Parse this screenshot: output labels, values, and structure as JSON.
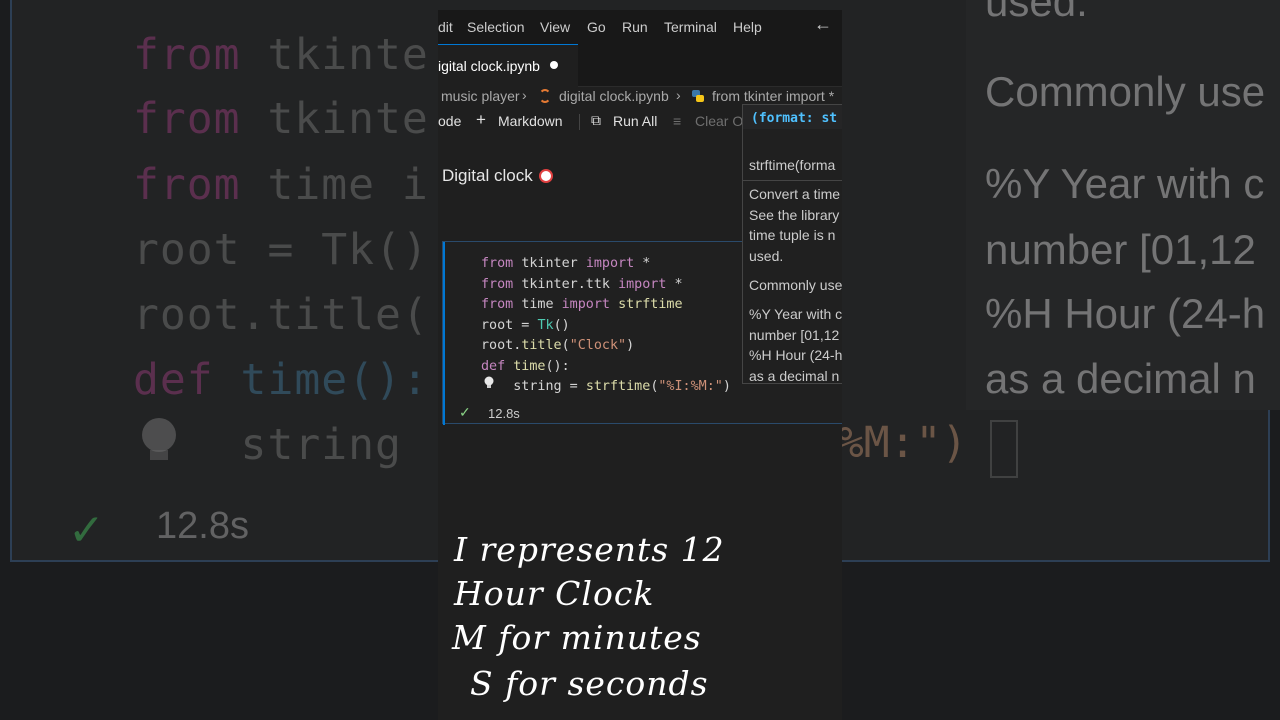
{
  "background": {
    "code_lines": [
      {
        "kw": "from",
        "rest": " tkinte"
      },
      {
        "kw": "from",
        "rest": " tkinte"
      },
      {
        "kw": "from",
        "rest": " time i"
      },
      {
        "kw": "",
        "rest": "root = Tk()"
      },
      {
        "kw": "",
        "rest": "root.title("
      },
      {
        "kw": "def",
        "rest": " time():"
      },
      {
        "kw": "",
        "rest": "    string "
      }
    ],
    "tail_text": ":%M:\")",
    "right_lines": [
      "used.",
      "Commonly use",
      "%Y Year with c",
      "number [01,12",
      "%H Hour (24-h",
      "as a decimal n"
    ],
    "status_time": "12.8s"
  },
  "menubar": {
    "items": [
      "dit",
      "Selection",
      "View",
      "Go",
      "Run",
      "Terminal",
      "Help"
    ]
  },
  "tab": {
    "label": "igital clock.ipynb"
  },
  "breadcrumb": {
    "folder": "music player",
    "file": "digital clock.ipynb",
    "cell": "from tkinter import *"
  },
  "toolbar": {
    "code_label": "ode",
    "markdown_label": "Markdown",
    "run_all_label": "Run All",
    "clear_label": "Clear O"
  },
  "markdown_cell": {
    "heading": "Digital clock"
  },
  "code_cell": {
    "lines": [
      "from tkinter import *",
      "from tkinter.ttk import *",
      "from time import strftime",
      "root = Tk()",
      "root.title(\"Clock\")",
      "def time():",
      "    string = strftime(\"%I:%M:\")"
    ],
    "exec_time": "12.8s"
  },
  "hover": {
    "signature": "(format: st",
    "lines": [
      "strftime(forma",
      "Convert a time",
      "See the library",
      "time tuple is n",
      "used.",
      "Commonly use",
      "%Y Year with c",
      "number [01,12",
      "%H Hour (24-h",
      "as a decimal n"
    ]
  },
  "caption": {
    "lines": [
      "I represents 12",
      "Hour Clock",
      "M for minutes",
      "S for seconds"
    ]
  },
  "colors": {
    "accent": "#0078d4",
    "keyword": "#c586c0",
    "function": "#dcdcaa",
    "class": "#4ec9b0",
    "string": "#ce9178",
    "success": "#89d185"
  }
}
